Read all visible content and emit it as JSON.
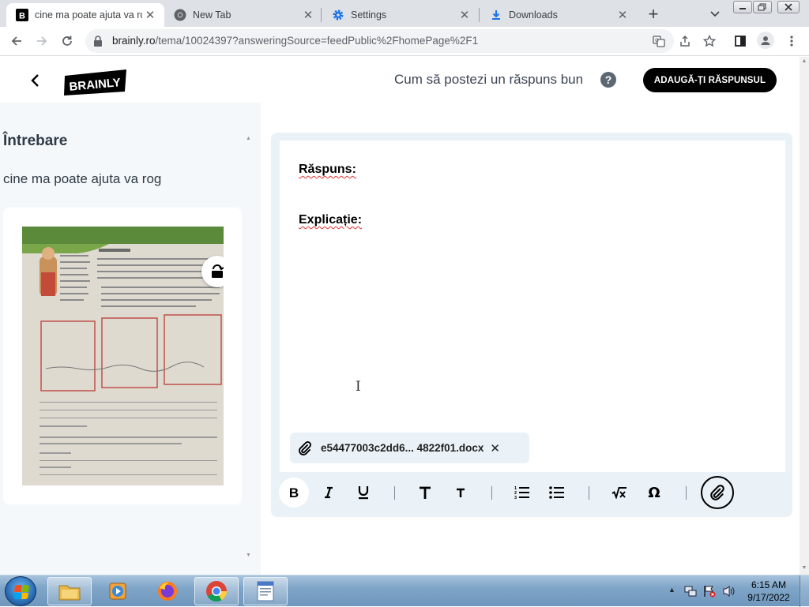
{
  "browser": {
    "tabs": [
      {
        "title": "cine ma poate ajuta va rog",
        "icon": "brainly-favicon",
        "active": true
      },
      {
        "title": "New Tab",
        "icon": "chrome-icon",
        "active": false
      },
      {
        "title": "Settings",
        "icon": "settings-gear-icon",
        "active": false
      },
      {
        "title": "Downloads",
        "icon": "download-icon",
        "active": false
      }
    ],
    "url_host": "brainly.ro",
    "url_path": "/tema/10024397?answeringSource=feedPublic%2FhomePage%2F1"
  },
  "header": {
    "logo_text": "BRAINLY",
    "howto_text": "Cum să postezi un răspuns bun",
    "help_icon_text": "?",
    "add_answer_label": "ADAUGĂ-ȚI RĂSPUNSUL"
  },
  "question": {
    "heading": "Întrebare",
    "text": "cine ma poate ajuta va rog"
  },
  "editor": {
    "answer_label": "Răspuns:",
    "explanation_label": "Explicație:",
    "attachment_name": "e54477003c2dd6... 4822f01.docx",
    "toolbar": [
      "bold",
      "italic",
      "underline",
      "heading-large",
      "heading-small",
      "numbered-list",
      "bulleted-list",
      "math-formula",
      "special-symbol",
      "attach"
    ]
  },
  "taskbar": {
    "time": "6:15 AM",
    "date": "9/17/2022",
    "apps": [
      "windows-explorer",
      "media-player",
      "firefox",
      "chrome",
      "notepad-document"
    ]
  },
  "colors": {
    "brand_black": "#000000",
    "editor_bg": "#ebf2f7",
    "left_panel_bg": "#f5f8fa",
    "spellcheck_red": "#e03030"
  }
}
